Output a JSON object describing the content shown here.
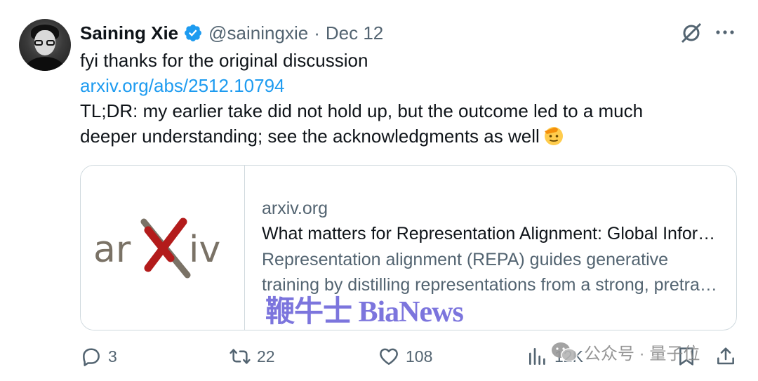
{
  "author": {
    "name": "Saining Xie",
    "handle": "@sainingxie",
    "separator": "·",
    "date": "Dec 12"
  },
  "tweet": {
    "line1": "fyi thanks for the original discussion",
    "link": "arxiv.org/abs/2512.10794",
    "line3": "TL;DR: my earlier take did not hold up, but the outcome led to a much",
    "line4": "deeper understanding; see the acknowledgments as well",
    "emoji": "saluting-face-emoji"
  },
  "card": {
    "logo_text_left": "ar",
    "logo_text_x": "X",
    "logo_text_right": "iv",
    "domain": "arxiv.org",
    "title": "What matters for Representation Alignment: Global Information or Spatial Structure?",
    "desc_line1": "Representation alignment (REPA) guides generative",
    "desc_line2": "training by distilling representations from a strong, pretrained visual encoder"
  },
  "actions": {
    "replies": "3",
    "reposts": "22",
    "likes": "108",
    "views": "12K"
  },
  "watermarks": {
    "bianews": "鞭牛士 BiaNews",
    "wechat": "公众号 · 量子位"
  },
  "icons": [
    "verified-badge-icon",
    "grok-icon",
    "more-icon",
    "reply-icon",
    "repost-icon",
    "like-icon",
    "views-icon",
    "bookmark-icon",
    "share-icon",
    "wechat-icon"
  ],
  "colors": {
    "link": "#1d9bf0",
    "secondary": "#536471",
    "text": "#0f1419",
    "arxiv_red": "#b31b1b",
    "arxiv_gray": "#7a7266",
    "watermark": "#6b63d9"
  }
}
